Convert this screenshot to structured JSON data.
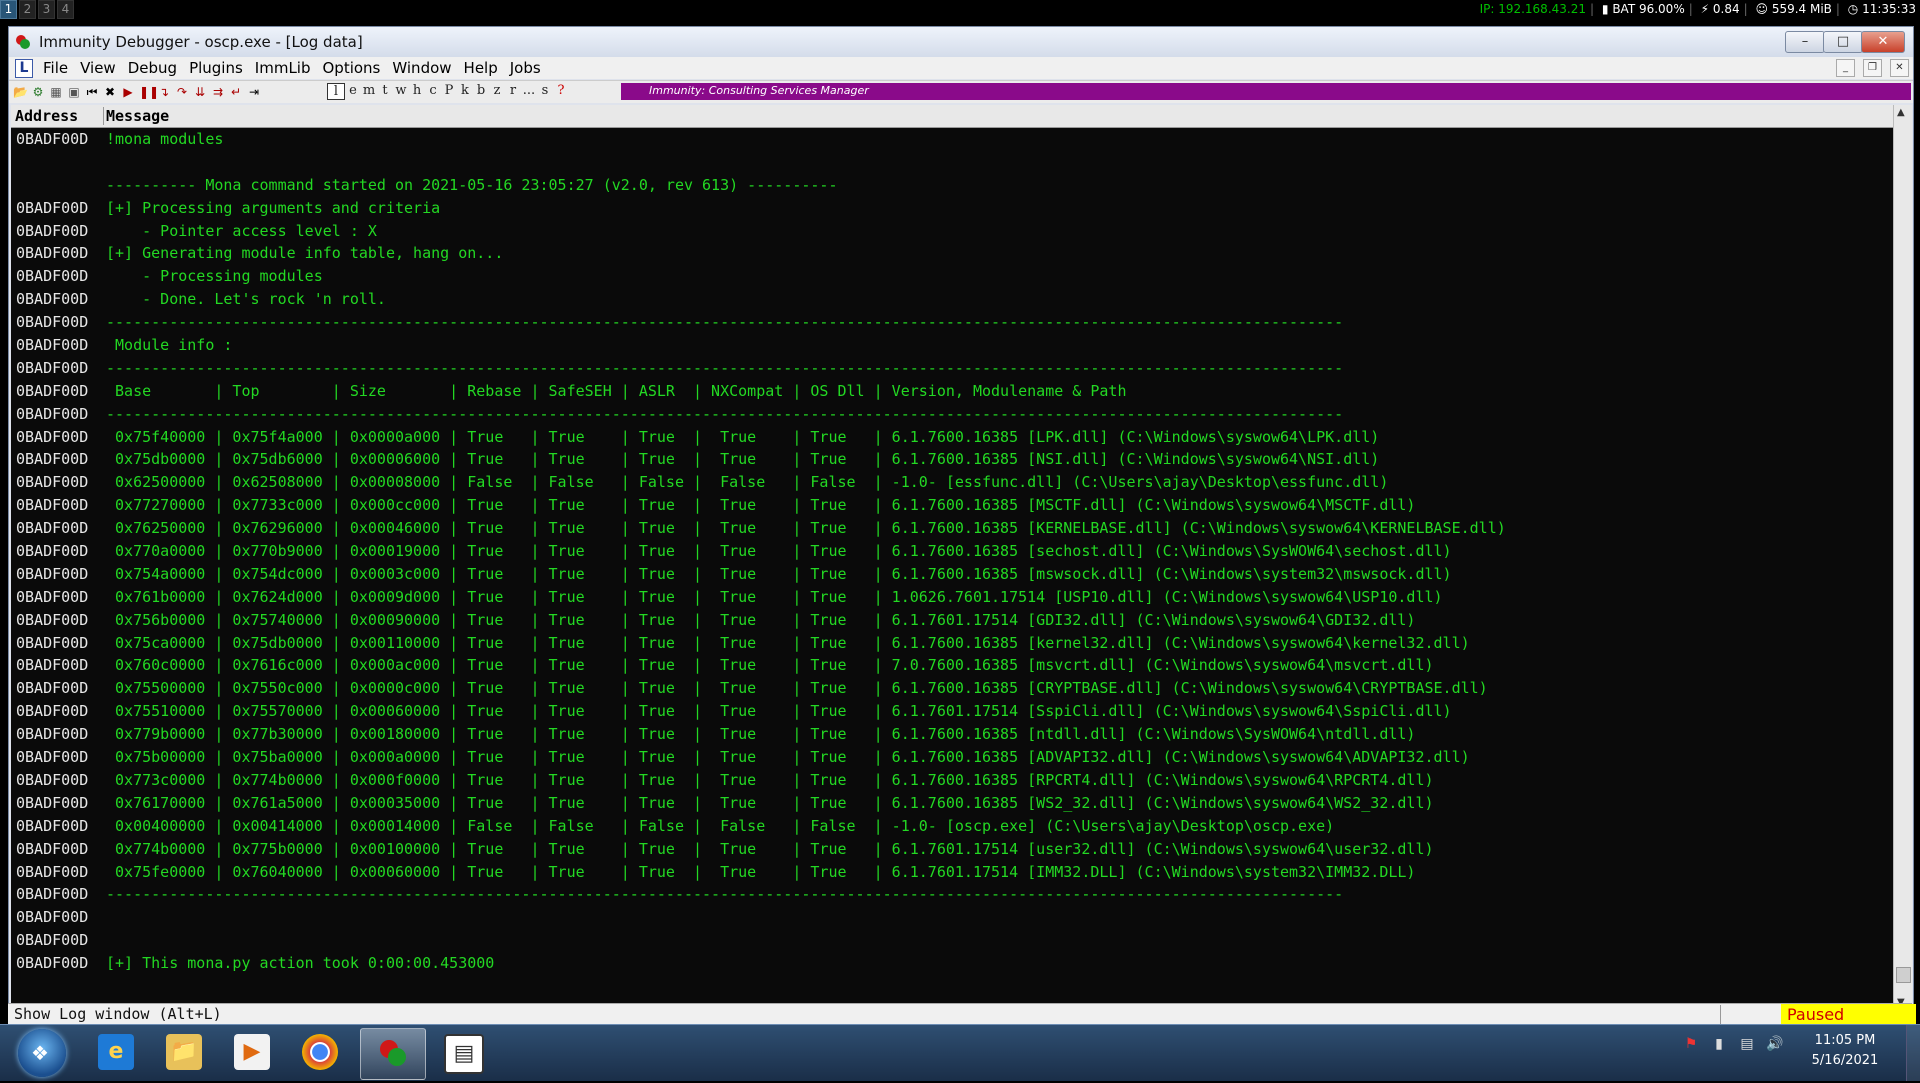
{
  "topbar": {
    "workspaces": [
      "1",
      "2",
      "3",
      "4"
    ],
    "ip": "IP: 192.168.43.21",
    "battery": "BAT 96.00%",
    "load": "0.84",
    "memory": "559.4 MiB",
    "time": "11:35:33"
  },
  "window": {
    "title": "Immunity Debugger - oscp.exe - [Log data]",
    "min_label": "–",
    "max_label": "□",
    "close_label": "✕"
  },
  "menubar": {
    "logo": "L",
    "items": [
      "File",
      "View",
      "Debug",
      "Plugins",
      "ImmLib",
      "Options",
      "Window",
      "Help",
      "Jobs"
    ]
  },
  "toolbar": {
    "letters": [
      "l",
      "e",
      "m",
      "t",
      "w",
      "h",
      "c",
      "P",
      "k",
      "b",
      "z",
      "r",
      "...",
      "s",
      "?"
    ],
    "banner": "Immunity: Consulting Services Manager"
  },
  "log": {
    "col_address": "Address",
    "col_message": "Message",
    "rows": [
      {
        "addr": "0BADF00D",
        "msg": "!mona modules"
      },
      {
        "addr": "",
        "msg": ""
      },
      {
        "addr": "",
        "msg": "---------- Mona command started on 2021-05-16 23:05:27 (v2.0, rev 613) ----------"
      },
      {
        "addr": "0BADF00D",
        "msg": "[+] Processing arguments and criteria"
      },
      {
        "addr": "0BADF00D",
        "msg": "    - Pointer access level : X"
      },
      {
        "addr": "0BADF00D",
        "msg": "[+] Generating module info table, hang on..."
      },
      {
        "addr": "0BADF00D",
        "msg": "    - Processing modules"
      },
      {
        "addr": "0BADF00D",
        "msg": "    - Done. Let's rock 'n roll."
      },
      {
        "addr": "0BADF00D",
        "msg": "-----------------------------------------------------------------------------------------------------------------------------------------"
      },
      {
        "addr": "0BADF00D",
        "msg": " Module info :"
      },
      {
        "addr": "0BADF00D",
        "msg": "-----------------------------------------------------------------------------------------------------------------------------------------"
      },
      {
        "addr": "0BADF00D",
        "msg": " Base       | Top        | Size       | Rebase | SafeSEH | ASLR  | NXCompat | OS Dll | Version, Modulename & Path"
      },
      {
        "addr": "0BADF00D",
        "msg": "-----------------------------------------------------------------------------------------------------------------------------------------"
      },
      {
        "addr": "0BADF00D",
        "msg": " 0x75f40000 | 0x75f4a000 | 0x0000a000 | True   | True    | True  |  True    | True   | 6.1.7600.16385 [LPK.dll] (C:\\Windows\\syswow64\\LPK.dll)"
      },
      {
        "addr": "0BADF00D",
        "msg": " 0x75db0000 | 0x75db6000 | 0x00006000 | True   | True    | True  |  True    | True   | 6.1.7600.16385 [NSI.dll] (C:\\Windows\\syswow64\\NSI.dll)"
      },
      {
        "addr": "0BADF00D",
        "msg": " 0x62500000 | 0x62508000 | 0x00008000 | False  | False   | False |  False   | False  | -1.0- [essfunc.dll] (C:\\Users\\ajay\\Desktop\\essfunc.dll)"
      },
      {
        "addr": "0BADF00D",
        "msg": " 0x77270000 | 0x7733c000 | 0x000cc000 | True   | True    | True  |  True    | True   | 6.1.7600.16385 [MSCTF.dll] (C:\\Windows\\syswow64\\MSCTF.dll)"
      },
      {
        "addr": "0BADF00D",
        "msg": " 0x76250000 | 0x76296000 | 0x00046000 | True   | True    | True  |  True    | True   | 6.1.7600.16385 [KERNELBASE.dll] (C:\\Windows\\syswow64\\KERNELBASE.dll)"
      },
      {
        "addr": "0BADF00D",
        "msg": " 0x770a0000 | 0x770b9000 | 0x00019000 | True   | True    | True  |  True    | True   | 6.1.7600.16385 [sechost.dll] (C:\\Windows\\SysWOW64\\sechost.dll)"
      },
      {
        "addr": "0BADF00D",
        "msg": " 0x754a0000 | 0x754dc000 | 0x0003c000 | True   | True    | True  |  True    | True   | 6.1.7600.16385 [mswsock.dll] (C:\\Windows\\system32\\mswsock.dll)"
      },
      {
        "addr": "0BADF00D",
        "msg": " 0x761b0000 | 0x7624d000 | 0x0009d000 | True   | True    | True  |  True    | True   | 1.0626.7601.17514 [USP10.dll] (C:\\Windows\\syswow64\\USP10.dll)"
      },
      {
        "addr": "0BADF00D",
        "msg": " 0x756b0000 | 0x75740000 | 0x00090000 | True   | True    | True  |  True    | True   | 6.1.7601.17514 [GDI32.dll] (C:\\Windows\\syswow64\\GDI32.dll)"
      },
      {
        "addr": "0BADF00D",
        "msg": " 0x75ca0000 | 0x75db0000 | 0x00110000 | True   | True    | True  |  True    | True   | 6.1.7600.16385 [kernel32.dll] (C:\\Windows\\syswow64\\kernel32.dll)"
      },
      {
        "addr": "0BADF00D",
        "msg": " 0x760c0000 | 0x7616c000 | 0x000ac000 | True   | True    | True  |  True    | True   | 7.0.7600.16385 [msvcrt.dll] (C:\\Windows\\syswow64\\msvcrt.dll)"
      },
      {
        "addr": "0BADF00D",
        "msg": " 0x75500000 | 0x7550c000 | 0x0000c000 | True   | True    | True  |  True    | True   | 6.1.7600.16385 [CRYPTBASE.dll] (C:\\Windows\\syswow64\\CRYPTBASE.dll)"
      },
      {
        "addr": "0BADF00D",
        "msg": " 0x75510000 | 0x75570000 | 0x00060000 | True   | True    | True  |  True    | True   | 6.1.7601.17514 [SspiCli.dll] (C:\\Windows\\syswow64\\SspiCli.dll)"
      },
      {
        "addr": "0BADF00D",
        "msg": " 0x779b0000 | 0x77b30000 | 0x00180000 | True   | True    | True  |  True    | True   | 6.1.7600.16385 [ntdll.dll] (C:\\Windows\\SysWOW64\\ntdll.dll)"
      },
      {
        "addr": "0BADF00D",
        "msg": " 0x75b00000 | 0x75ba0000 | 0x000a0000 | True   | True    | True  |  True    | True   | 6.1.7600.16385 [ADVAPI32.dll] (C:\\Windows\\syswow64\\ADVAPI32.dll)"
      },
      {
        "addr": "0BADF00D",
        "msg": " 0x773c0000 | 0x774b0000 | 0x000f0000 | True   | True    | True  |  True    | True   | 6.1.7600.16385 [RPCRT4.dll] (C:\\Windows\\syswow64\\RPCRT4.dll)"
      },
      {
        "addr": "0BADF00D",
        "msg": " 0x76170000 | 0x761a5000 | 0x00035000 | True   | True    | True  |  True    | True   | 6.1.7600.16385 [WS2_32.dll] (C:\\Windows\\syswow64\\WS2_32.dll)"
      },
      {
        "addr": "0BADF00D",
        "msg": " 0x00400000 | 0x00414000 | 0x00014000 | False  | False   | False |  False   | False  | -1.0- [oscp.exe] (C:\\Users\\ajay\\Desktop\\oscp.exe)"
      },
      {
        "addr": "0BADF00D",
        "msg": " 0x774b0000 | 0x775b0000 | 0x00100000 | True   | True    | True  |  True    | True   | 6.1.7601.17514 [user32.dll] (C:\\Windows\\syswow64\\user32.dll)"
      },
      {
        "addr": "0BADF00D",
        "msg": " 0x75fe0000 | 0x76040000 | 0x00060000 | True   | True    | True  |  True    | True   | 6.1.7601.17514 [IMM32.DLL] (C:\\Windows\\system32\\IMM32.DLL)"
      },
      {
        "addr": "0BADF00D",
        "msg": "-----------------------------------------------------------------------------------------------------------------------------------------"
      },
      {
        "addr": "0BADF00D",
        "msg": ""
      },
      {
        "addr": "0BADF00D",
        "msg": ""
      },
      {
        "addr": "0BADF00D",
        "msg": "[+] This mona.py action took 0:00:00.453000"
      }
    ]
  },
  "command": {
    "value": "!mona modules"
  },
  "statusbar": {
    "hint": "Show Log window (Alt+L)",
    "state": "Paused"
  },
  "taskbar": {
    "clock_time": "11:05 PM",
    "clock_date": "5/16/2021"
  },
  "colors": {
    "log_text": "#23d823",
    "banner": "#8a0a8a",
    "paused_bg": "#ffff00",
    "paused_text": "#d00000"
  }
}
